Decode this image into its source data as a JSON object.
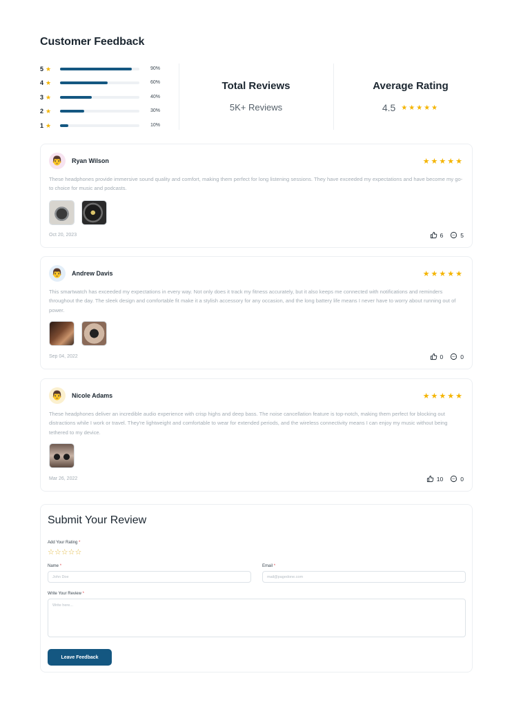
{
  "page_title": "Customer Feedback",
  "rating_distribution": [
    {
      "stars": "5",
      "percent_label": "90%",
      "fraction": 0.9
    },
    {
      "stars": "4",
      "percent_label": "60%",
      "fraction": 0.6
    },
    {
      "stars": "3",
      "percent_label": "40%",
      "fraction": 0.4
    },
    {
      "stars": "2",
      "percent_label": "30%",
      "fraction": 0.3
    },
    {
      "stars": "1",
      "percent_label": "10%",
      "fraction": 0.1
    }
  ],
  "total_reviews": {
    "title": "Total Reviews",
    "value": "5K+ Reviews"
  },
  "average_rating": {
    "title": "Average Rating",
    "value": "4.5",
    "stars": "★★★★★"
  },
  "colors": {
    "accent": "#145781",
    "star": "#f4b400"
  },
  "reviews": [
    {
      "name": "Ryan Wilson",
      "avatar": "👨",
      "stars": "★★★★★",
      "text": "These headphones provide immersive sound quality and comfort, making them perfect for long listening sessions. They have exceeded my expectations and have become my go-to choice for music and podcasts.",
      "date": "Oct 20, 2023",
      "likes": "6",
      "comments": "5"
    },
    {
      "name": "Andrew Davis",
      "avatar": "👨",
      "stars": "★★★★★",
      "text": "This smartwatch has exceeded my expectations in every way. Not only does it track my fitness accurately, but it also keeps me connected with notifications and reminders throughout the day. The sleek design and comfortable fit make it a stylish accessory for any occasion, and the long battery life means I never have to worry about running out of power.",
      "date": "Sep 04, 2022",
      "likes": "0",
      "comments": "0"
    },
    {
      "name": "Nicole Adams",
      "avatar": "👨",
      "stars": "★★★★★",
      "text": "These headphones deliver an incredible audio experience with crisp highs and deep bass. The noise cancellation feature is top-notch, making them perfect for blocking out distractions while I work or travel. They're lightweight and comfortable to wear for extended periods, and the wireless connectivity means I can enjoy my music without being tethered to my device.",
      "date": "Mar 26, 2022",
      "likes": "10",
      "comments": "0"
    }
  ],
  "form": {
    "title": "Submit Your Review",
    "rating_label": "Add Your Rating",
    "rating_stars": "☆☆☆☆☆",
    "name_label": "Name",
    "name_placeholder": "John Doe",
    "email_label": "Email",
    "email_placeholder": "mail@pagedone.com",
    "review_label": "Write Your Review",
    "review_placeholder": "Write here...",
    "submit_label": "Leave Feedback",
    "required_mark": "*"
  }
}
